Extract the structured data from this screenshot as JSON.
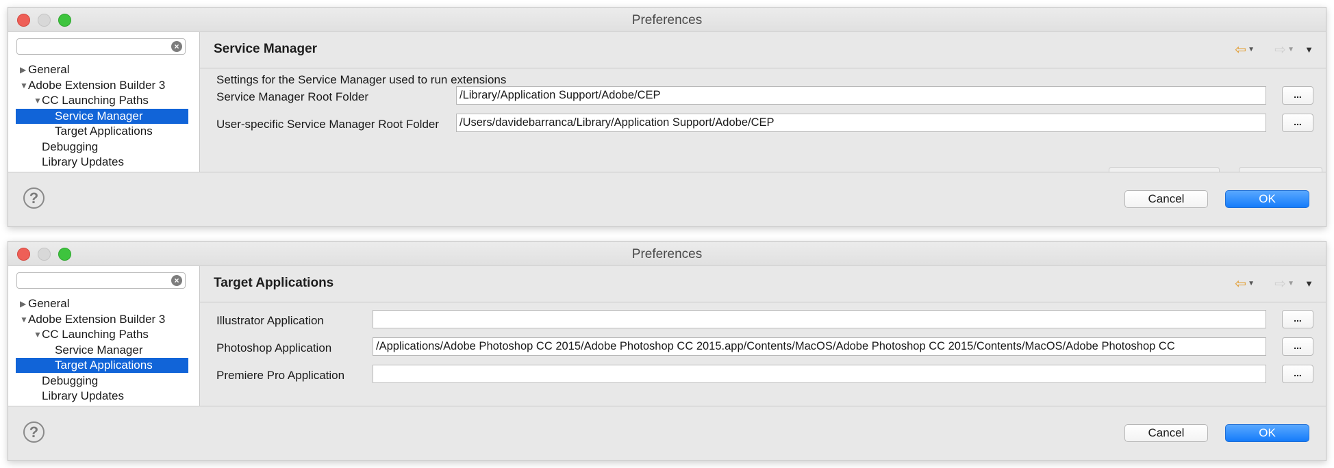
{
  "window1": {
    "title": "Preferences",
    "search": {
      "value": "",
      "placeholder": ""
    },
    "tree": [
      {
        "label": "General",
        "arrow": "▶"
      },
      {
        "label": "Adobe Extension Builder 3",
        "arrow": "▼"
      },
      {
        "label": "CC Launching Paths",
        "arrow": "▼"
      },
      {
        "label": "Service Manager",
        "arrow": ""
      },
      {
        "label": "Target Applications",
        "arrow": ""
      },
      {
        "label": "Debugging",
        "arrow": ""
      },
      {
        "label": "Library Updates",
        "arrow": ""
      }
    ],
    "selected_item": "Service Manager",
    "page_title": "Service Manager",
    "description": "Settings for the Service Manager used to run extensions",
    "fields": [
      {
        "label": "Service Manager Root Folder",
        "value": "/Library/Application Support/Adobe/CEP",
        "button": "..."
      },
      {
        "label": "User-specific Service Manager Root Folder",
        "value": "/Users/davidebarranca/Library/Application Support/Adobe/CEP",
        "button": "..."
      }
    ],
    "cancel_label": "Cancel",
    "ok_label": "OK"
  },
  "window2": {
    "title": "Preferences",
    "search": {
      "value": "",
      "placeholder": ""
    },
    "tree": [
      {
        "label": "General",
        "arrow": "▶"
      },
      {
        "label": "Adobe Extension Builder 3",
        "arrow": "▼"
      },
      {
        "label": "CC Launching Paths",
        "arrow": "▼"
      },
      {
        "label": "Service Manager",
        "arrow": ""
      },
      {
        "label": "Target Applications",
        "arrow": ""
      },
      {
        "label": "Debugging",
        "arrow": ""
      },
      {
        "label": "Library Updates",
        "arrow": ""
      }
    ],
    "selected_item": "Target Applications",
    "page_title": "Target Applications",
    "fields": [
      {
        "label": "Illustrator Application",
        "value": "",
        "button": "..."
      },
      {
        "label": "Photoshop Application",
        "value": "/Applications/Adobe Photoshop CC 2015/Adobe Photoshop CC 2015.app/Contents/MacOS/Adobe Photoshop CC 2015/Contents/MacOS/Adobe Photoshop CC",
        "button": "..."
      },
      {
        "label": "Premiere Pro Application",
        "value": "",
        "button": "..."
      }
    ],
    "cancel_label": "Cancel",
    "ok_label": "OK"
  },
  "icons": {
    "back": "back-arrow-icon",
    "forward": "forward-arrow-icon",
    "view_menu": "view-menu-icon",
    "help": "help-icon",
    "search_clear": "clear-search-icon"
  },
  "colors": {
    "selection": "#1164d8",
    "ok_button": "#157cfa",
    "back_arrow": "#e29b2d",
    "close": "#ee5f57",
    "maximize": "#3ec43e"
  }
}
